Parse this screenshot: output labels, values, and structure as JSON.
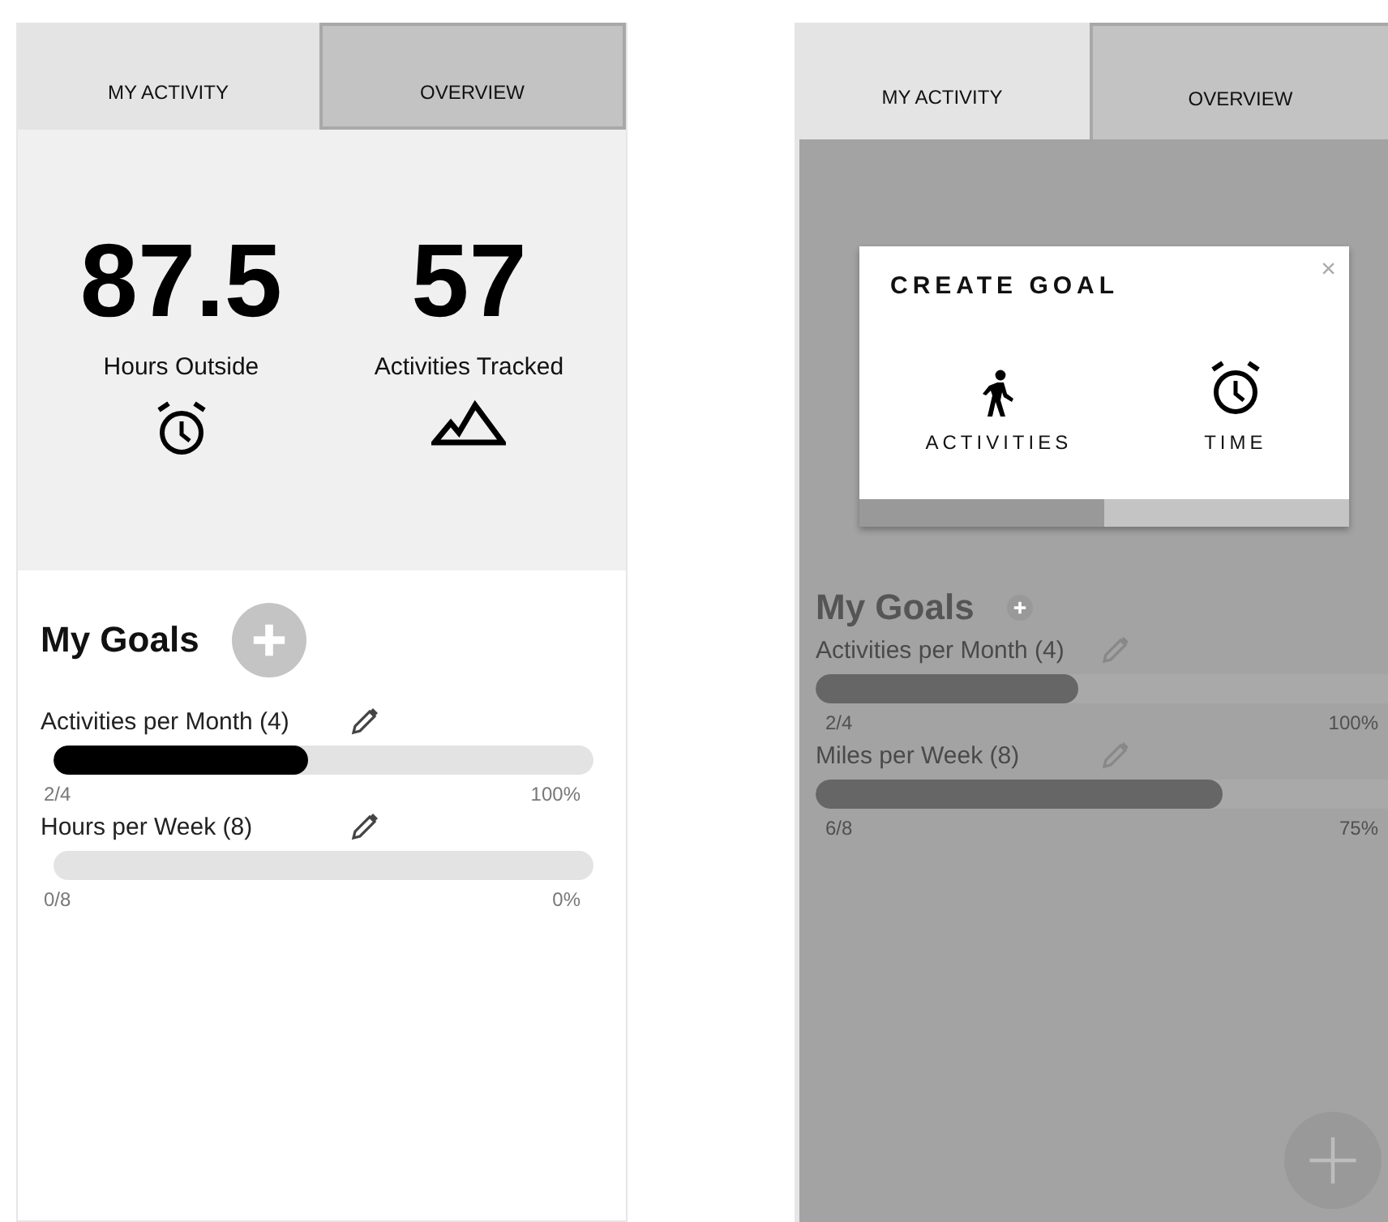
{
  "screens": [
    {
      "kind": "overview",
      "tabs": [
        {
          "label": "MY ACTIVITY",
          "selected": false
        },
        {
          "label": "OVERVIEW",
          "selected": true
        }
      ],
      "stats": [
        {
          "value": "87.5",
          "label": "Hours Outside",
          "kind": "time"
        },
        {
          "value": "57",
          "label": "Activities Tracked",
          "kind": "activity"
        }
      ],
      "goals_title": "My Goals",
      "goals": [
        {
          "label": "Activities per Month (4)",
          "level": 0.47,
          "count": "2/4",
          "percent": "100%"
        },
        {
          "label": "Hours per Week (8)",
          "count": "0/8",
          "percent": "0%"
        }
      ]
    },
    {
      "kind": "dialog",
      "tabs": [
        {
          "label": "MY ACTIVITY",
          "selected": false
        },
        {
          "label": "OVERVIEW",
          "selected": true
        }
      ],
      "goals_title": "My Goals",
      "goals": [
        {
          "label": "Activities per Month (4)",
          "level": 0.46,
          "count": "2/4",
          "percent": "100%"
        },
        {
          "label": "Miles per Week (8)",
          "level": 0.71,
          "count": "6/8",
          "percent": "75%"
        }
      ],
      "dialog": {
        "title": "CREATE GOAL",
        "close": "×",
        "options": [
          {
            "label": "ACTIVITIES",
            "kind": "activity",
            "selected": true
          },
          {
            "label": "TIME",
            "kind": "time",
            "selected": false
          }
        ]
      }
    }
  ]
}
